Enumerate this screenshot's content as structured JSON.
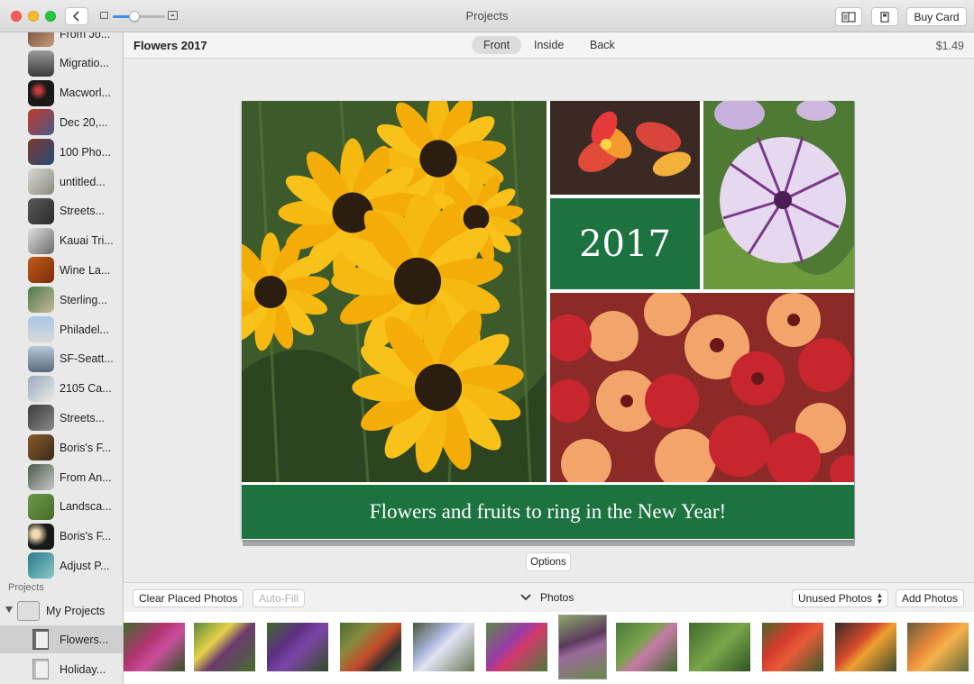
{
  "window": {
    "title": "Projects"
  },
  "toolbar": {
    "buy_card_label": "Buy Card"
  },
  "sidebar": {
    "items": [
      {
        "label": "From Jo..."
      },
      {
        "label": "Migratio..."
      },
      {
        "label": "Macworl..."
      },
      {
        "label": "Dec 20,..."
      },
      {
        "label": "100 Pho..."
      },
      {
        "label": "untitled..."
      },
      {
        "label": "Streets..."
      },
      {
        "label": "Kauai Tri..."
      },
      {
        "label": "Wine La..."
      },
      {
        "label": "Sterling..."
      },
      {
        "label": "Philadel..."
      },
      {
        "label": "SF-Seatt..."
      },
      {
        "label": "2105 Ca..."
      },
      {
        "label": "Streets..."
      },
      {
        "label": "Boris's F..."
      },
      {
        "label": "From An..."
      },
      {
        "label": "Landsca..."
      },
      {
        "label": "Boris's F..."
      },
      {
        "label": "Adjust P..."
      }
    ],
    "section_title": "Projects",
    "projects": {
      "folder_label": "My Projects",
      "items": [
        {
          "label": "Flowers...",
          "selected": true
        },
        {
          "label": "Holiday..."
        }
      ]
    }
  },
  "header": {
    "project_title": "Flowers 2017",
    "tabs": [
      {
        "label": "Front",
        "active": true
      },
      {
        "label": "Inside"
      },
      {
        "label": "Back"
      }
    ],
    "price": "$1.49"
  },
  "card": {
    "year_text": "2017",
    "banner_text": "Flowers and fruits to ring in the New Year!",
    "accent_color": "#1c7340"
  },
  "options_label": "Options",
  "bottombar": {
    "clear_label": "Clear Placed Photos",
    "autofill_label": "Auto-Fill",
    "photos_label": "Photos",
    "filter_label": "Unused Photos",
    "add_label": "Add Photos"
  }
}
